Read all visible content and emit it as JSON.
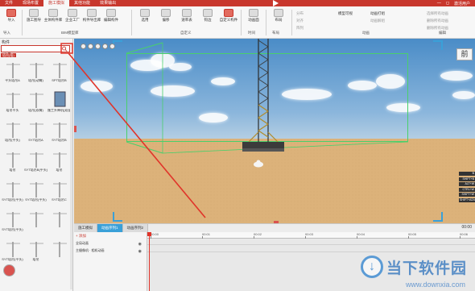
{
  "titlebar": {
    "tabs": [
      "文件",
      "现场布置",
      "施工模拟",
      "其他功能",
      "效果输出"
    ],
    "active_tab": 2,
    "right_items": [
      "—",
      "◻",
      "激活用户"
    ]
  },
  "ribbon": {
    "buttons": [
      {
        "label": "导入",
        "icon": "import-icon"
      },
      {
        "label": "施工图导",
        "icon": "drawing-icon"
      },
      {
        "label": "主体构件库",
        "icon": "library-icon"
      },
      {
        "label": "企业工厂",
        "icon": "factory-icon"
      },
      {
        "label": "构件导出库",
        "icon": "export-icon"
      },
      {
        "label": "编辑构件",
        "icon": "edit-icon"
      },
      {
        "label": "选用",
        "icon": "select-icon"
      },
      {
        "label": "偏移",
        "icon": "offset-icon"
      },
      {
        "label": "速率表",
        "icon": "rate-icon"
      },
      {
        "label": "钩边",
        "icon": "hook-icon"
      },
      {
        "label": "自定义构件",
        "icon": "custom-icon"
      },
      {
        "label": "动画面",
        "icon": "animation-icon"
      },
      {
        "label": "布局",
        "icon": "layout-icon"
      }
    ],
    "groups": [
      "导入",
      "BIM模型库",
      "自定义",
      "时间",
      "布局",
      "动画",
      "编辑"
    ],
    "small_items": [
      "分布",
      "对齐",
      "阵列",
      "模型可视",
      "动画打组",
      "动画解组",
      "选择所有动画",
      "删除所有动画",
      "删除所有动画"
    ]
  },
  "left_panel": {
    "title": "构件",
    "search_placeholder": "",
    "search_value": "塔吊",
    "tag": "塔吊(塔)",
    "assets": [
      "平头塔吊A",
      "塔吊(动臂)",
      "SPT塔吊B",
      "塔吊平头",
      "塔吊(双臂)",
      "施工升降机(双笼)",
      "塔吊(平头)",
      "SYT塔吊A",
      "SYT塔吊B",
      "塔吊",
      "SYT塔吊B(平头)",
      "塔吊",
      "SYT塔吊(平头)",
      "SYT塔吊(平头)",
      "SYT塔吊C",
      "SYT塔吊(平头)",
      "",
      "",
      "SYT塔吊(平头)",
      "塔吊",
      ""
    ]
  },
  "viewport": {
    "view_label": "前",
    "key_hints": [
      "B",
      "SHIFT+B",
      "ALT+W",
      "CTRL+W",
      "SHIFT+W",
      "SHIFT+ADV"
    ]
  },
  "timeline": {
    "tabs": [
      "施工模拟",
      "动画序列1",
      "动画序列2"
    ],
    "active_tab": 1,
    "time_display": "00:00",
    "add_label": "+ 添加",
    "rows": [
      "全局动画",
      "主摄像机 · 相机动画"
    ],
    "ruler_ticks": [
      "00:00",
      "00:01",
      "00:02",
      "00:03",
      "00:04",
      "00:05",
      "00:06"
    ]
  },
  "watermark": {
    "text": "当下软件园",
    "url": "www.downxia.com"
  }
}
